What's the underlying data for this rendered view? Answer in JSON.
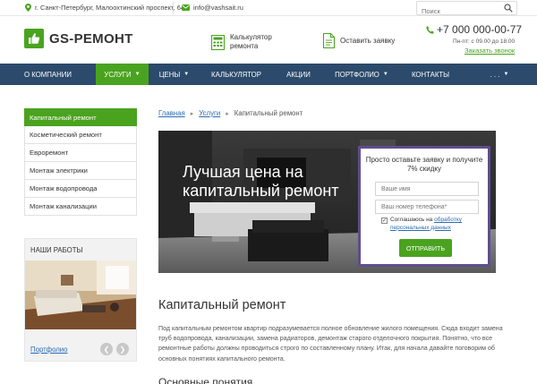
{
  "topbar": {
    "address": "г. Санкт-Петербург, Малоохтинский проспект, 64А",
    "email": "info@vashsait.ru",
    "search_placeholder": "Поиск"
  },
  "header": {
    "logo_text": "GS-РЕМОНТ",
    "calc_link": "Калькулятор ремонта",
    "request_link": "Оставить заявку",
    "phone": "+7 000 000-00-77",
    "hours": "Пн-пт: с 09.00 до 18.00",
    "callback": "Заказать звонок"
  },
  "nav": {
    "items": [
      {
        "label": "О КОМПАНИИ"
      },
      {
        "label": "УСЛУГИ"
      },
      {
        "label": "ЦЕНЫ"
      },
      {
        "label": "КАЛЬКУЛЯТОР"
      },
      {
        "label": "АКЦИИ"
      },
      {
        "label": "ПОРТФОЛИО"
      },
      {
        "label": "КОНТАКТЫ"
      },
      {
        "label": ". . ."
      }
    ]
  },
  "sidebar": {
    "items": [
      {
        "label": "Капитальный ремонт"
      },
      {
        "label": "Косметический ремонт"
      },
      {
        "label": "Евроремонт"
      },
      {
        "label": "Монтаж электрики"
      },
      {
        "label": "Монтаж водопровода"
      },
      {
        "label": "Монтаж канализации"
      }
    ],
    "works_title": "НАШИ РАБОТЫ",
    "portfolio_link": "Портфолио"
  },
  "breadcrumb": {
    "home": "Главная",
    "services": "Услуги",
    "current": "Капитальный ремонт"
  },
  "hero": {
    "headline": "Лучшая цена на капитальный ремонт"
  },
  "form": {
    "title": "Просто оставьте заявку и получите 7% скидку",
    "name_placeholder": "Ваше имя",
    "phone_placeholder": "Ваш номер телефона*",
    "agree_text": "Соглашаюсь на",
    "agree_link": "обработку персональных данных",
    "submit": "ОТПРАВИТЬ"
  },
  "content": {
    "title": "Капитальный ремонт",
    "paragraph": "Под капитальным ремонтом квартир подразумевается полное обновление жилого помещения. Сюда входит замена труб водопровода, канализации, замена радиаторов, демонтаж старого отделочного покрытия. Понятно, что все ремонтные работы должны проводиться строго по составленному плану. Итак, для начала давайте поговорим об основных понятиях капитального ремонта.",
    "subtitle": "Основные понятия"
  },
  "colors": {
    "green": "#4aa31f",
    "navy": "#2c4a6b",
    "form_border": "#5f4d8e",
    "link": "#2b6bb0"
  }
}
